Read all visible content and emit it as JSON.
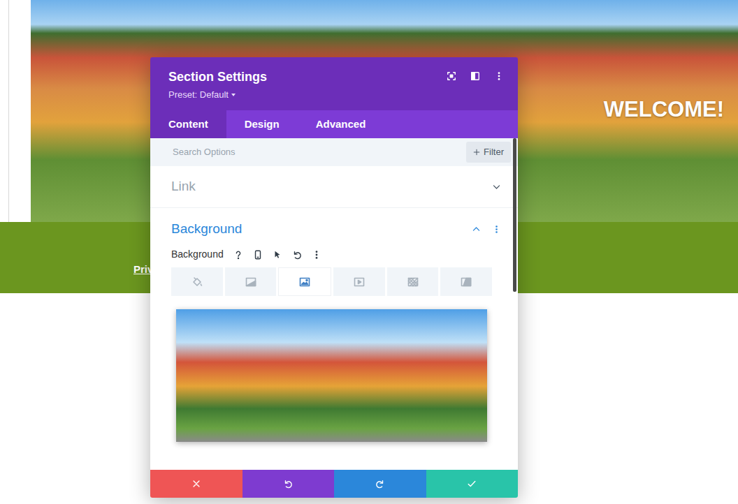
{
  "page": {
    "heading": "WELCOME!",
    "link": "Priv"
  },
  "modal": {
    "title": "Section Settings",
    "preset": "Preset: Default"
  },
  "tabs": [
    {
      "label": "Content",
      "selected": true
    },
    {
      "label": "Design",
      "selected": false
    },
    {
      "label": "Advanced",
      "selected": false
    }
  ],
  "search": {
    "placeholder": "Search Options",
    "filter": "Filter"
  },
  "sections": [
    {
      "title": "Link",
      "expanded": false
    },
    {
      "title": "Background",
      "expanded": true
    }
  ],
  "background": {
    "label": "Background",
    "types": [
      {
        "kind": "color",
        "selected": false
      },
      {
        "kind": "gradient",
        "selected": false
      },
      {
        "kind": "image",
        "selected": true
      },
      {
        "kind": "video",
        "selected": false
      },
      {
        "kind": "pattern",
        "selected": false
      },
      {
        "kind": "mask",
        "selected": false
      }
    ]
  }
}
